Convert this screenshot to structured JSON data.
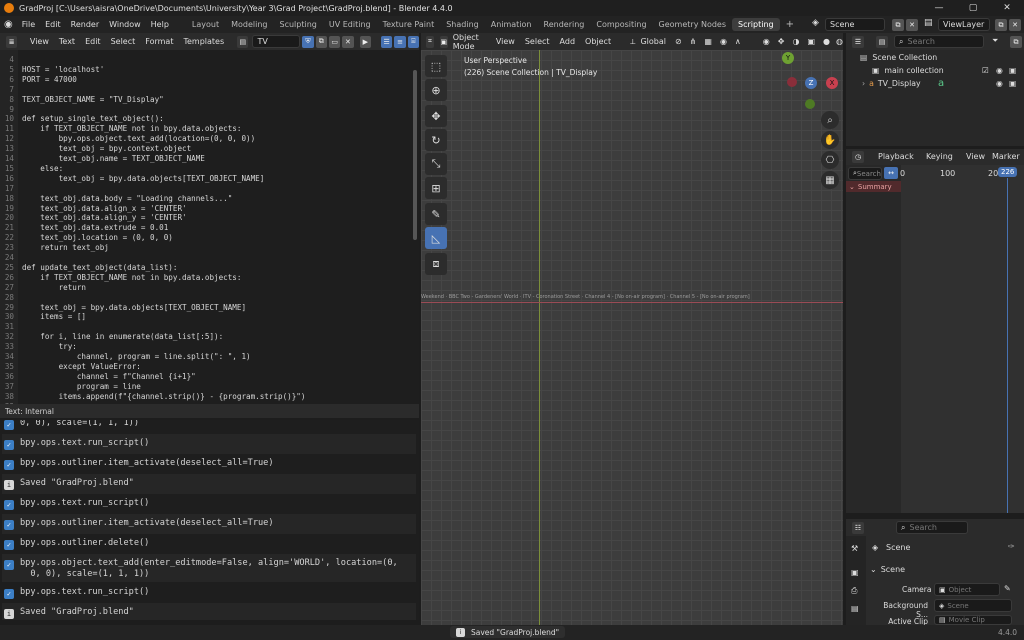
{
  "window": {
    "title": "GradProj [C:\\Users\\aisra\\OneDrive\\Documents\\University\\Year 3\\Grad Project\\GradProj.blend] - Blender 4.4.0",
    "controls": [
      "—",
      "▢",
      "✕"
    ]
  },
  "menubar": {
    "menus": [
      "File",
      "Edit",
      "Render",
      "Window",
      "Help"
    ],
    "workspaces": [
      "Layout",
      "Modeling",
      "Sculpting",
      "UV Editing",
      "Texture Paint",
      "Shading",
      "Animation",
      "Rendering",
      "Compositing",
      "Geometry Nodes",
      "Scripting"
    ],
    "active_workspace": "Scripting",
    "add_tab": "+",
    "scene": "Scene",
    "view_layer": "ViewLayer"
  },
  "text_editor": {
    "menus": [
      "View",
      "Text",
      "Edit",
      "Select",
      "Format",
      "Templates"
    ],
    "text_name": "TV",
    "footer": "Text: Internal",
    "lines": [
      {
        "n": "4",
        "t": ""
      },
      {
        "n": "5",
        "t": "HOST = 'localhost'"
      },
      {
        "n": "6",
        "t": "PORT = 47000"
      },
      {
        "n": "7",
        "t": ""
      },
      {
        "n": "8",
        "t": "TEXT_OBJECT_NAME = \"TV_Display\""
      },
      {
        "n": "9",
        "t": ""
      },
      {
        "n": "10",
        "t": "def setup_single_text_object():"
      },
      {
        "n": "11",
        "t": "    if TEXT_OBJECT_NAME not in bpy.data.objects:"
      },
      {
        "n": "12",
        "t": "        bpy.ops.object.text_add(location=(0, 0, 0))"
      },
      {
        "n": "13",
        "t": "        text_obj = bpy.context.object"
      },
      {
        "n": "14",
        "t": "        text_obj.name = TEXT_OBJECT_NAME"
      },
      {
        "n": "15",
        "t": "    else:"
      },
      {
        "n": "16",
        "t": "        text_obj = bpy.data.objects[TEXT_OBJECT_NAME]"
      },
      {
        "n": "17",
        "t": ""
      },
      {
        "n": "18",
        "t": "    text_obj.data.body = \"Loading channels...\""
      },
      {
        "n": "19",
        "t": "    text_obj.data.align_x = 'CENTER'"
      },
      {
        "n": "20",
        "t": "    text_obj.data.align_y = 'CENTER'"
      },
      {
        "n": "21",
        "t": "    text_obj.data.extrude = 0.01"
      },
      {
        "n": "22",
        "t": "    text_obj.location = (0, 0, 0)"
      },
      {
        "n": "23",
        "t": "    return text_obj"
      },
      {
        "n": "24",
        "t": ""
      },
      {
        "n": "25",
        "t": "def update_text_object(data_list):"
      },
      {
        "n": "26",
        "t": "    if TEXT_OBJECT_NAME not in bpy.data.objects:"
      },
      {
        "n": "27",
        "t": "        return"
      },
      {
        "n": "28",
        "t": ""
      },
      {
        "n": "29",
        "t": "    text_obj = bpy.data.objects[TEXT_OBJECT_NAME]"
      },
      {
        "n": "30",
        "t": "    items = []"
      },
      {
        "n": "31",
        "t": ""
      },
      {
        "n": "32",
        "t": "    for i, line in enumerate(data_list[:5]):"
      },
      {
        "n": "33",
        "t": "        try:"
      },
      {
        "n": "34",
        "t": "            channel, program = line.split(\": \", 1)"
      },
      {
        "n": "35",
        "t": "        except ValueError:"
      },
      {
        "n": "36",
        "t": "            channel = f\"Channel {i+1}\""
      },
      {
        "n": "37",
        "t": "            program = line"
      },
      {
        "n": "38",
        "t": "        items.append(f\"{channel.strip()} - {program.strip()}\")"
      },
      {
        "n": "39",
        "t": ""
      }
    ]
  },
  "info_log": {
    "entries": [
      {
        "type": "op",
        "text": "0, 0), scale=(1, 1, 1))"
      },
      {
        "type": "op",
        "text": "bpy.ops.text.run_script()"
      },
      {
        "type": "op",
        "text": "bpy.ops.outliner.item_activate(deselect_all=True)"
      },
      {
        "type": "info",
        "text": "Saved \"GradProj.blend\""
      },
      {
        "type": "op",
        "text": "bpy.ops.text.run_script()"
      },
      {
        "type": "op",
        "text": "bpy.ops.outliner.item_activate(deselect_all=True)"
      },
      {
        "type": "op",
        "text": "bpy.ops.outliner.delete()"
      },
      {
        "type": "op",
        "text": "bpy.ops.object.text_add(enter_editmode=False, align='WORLD', location=(0,\n  0, 0), scale=(1, 1, 1))"
      },
      {
        "type": "op",
        "text": "bpy.ops.text.run_script()"
      },
      {
        "type": "info",
        "text": "Saved \"GradProj.blend\""
      }
    ]
  },
  "viewport": {
    "mode": "Object Mode",
    "menus": [
      "View",
      "Select",
      "Add",
      "Object"
    ],
    "transform": "Global",
    "overlay_title": "User Perspective",
    "overlay_subtitle": "(226) Scene Collection | TV_Display",
    "scene_text": "Weekend · BBC Two - Gardeners' World · ITV - Coronation Street · Channel 4 - [No on-air program] · Channel 5 - [No on-air program]",
    "gizmo": {
      "y": "Y",
      "z": "Z",
      "x": "X"
    }
  },
  "outliner": {
    "search_placeholder": "Search",
    "items": [
      "Scene Collection",
      "main collection",
      "TV_Display"
    ]
  },
  "timeline": {
    "menus": [
      "Playback",
      "Keying",
      "View",
      "Marker"
    ],
    "search_placeholder": "Search",
    "ruler": [
      "0",
      "100",
      "20"
    ],
    "current_frame": "226",
    "channel": "Summary"
  },
  "properties": {
    "search_placeholder": "Search",
    "context": "Scene",
    "panel": "Scene",
    "rows": [
      {
        "label": "Camera",
        "value": "Object"
      },
      {
        "label": "Background S...",
        "value": "Scene"
      },
      {
        "label": "Active Clip",
        "value": "Movie Clip"
      }
    ]
  },
  "status": {
    "message": "Saved \"GradProj.blend\"",
    "version": "4.4.0"
  }
}
